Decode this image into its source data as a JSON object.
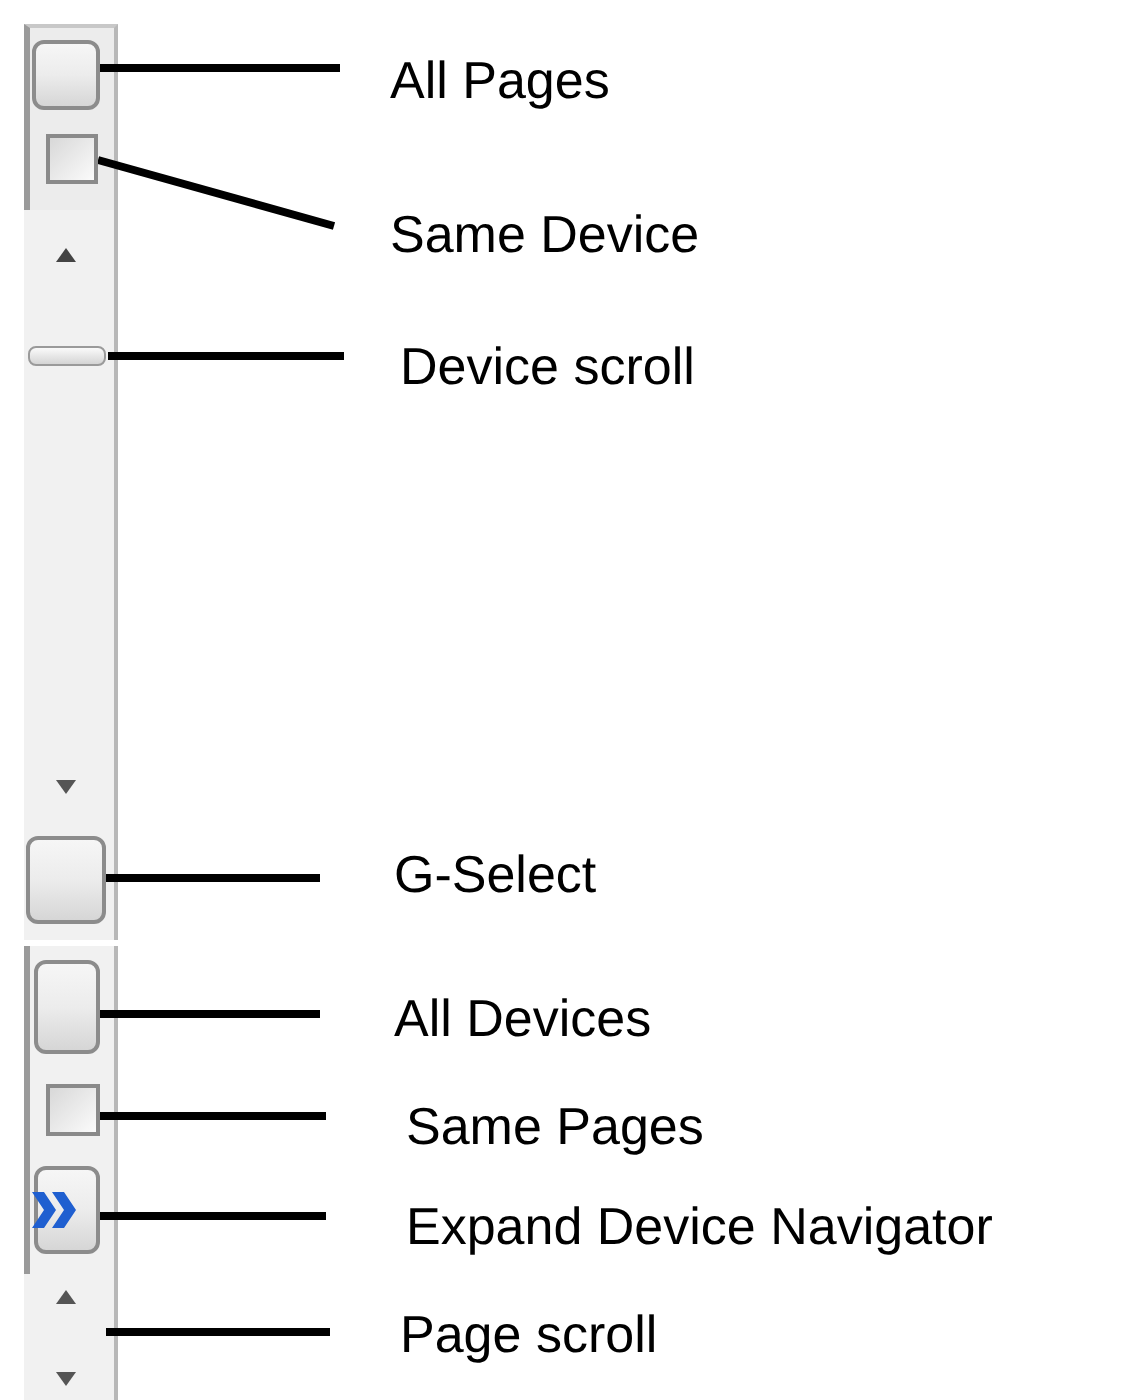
{
  "controls": [
    {
      "kind": "button",
      "label": "All Pages"
    },
    {
      "kind": "checkbox",
      "checked": false,
      "label": "Same Device"
    },
    {
      "kind": "scroll_thumb",
      "label": "Device scroll"
    },
    {
      "kind": "button",
      "label": "G-Select"
    },
    {
      "kind": "button",
      "label": "All Devices"
    },
    {
      "kind": "checkbox",
      "checked": false,
      "label": "Same Pages"
    },
    {
      "kind": "expand_button",
      "label": "Expand Device Navigator"
    },
    {
      "kind": "scroll_arrows",
      "label": "Page scroll"
    }
  ]
}
